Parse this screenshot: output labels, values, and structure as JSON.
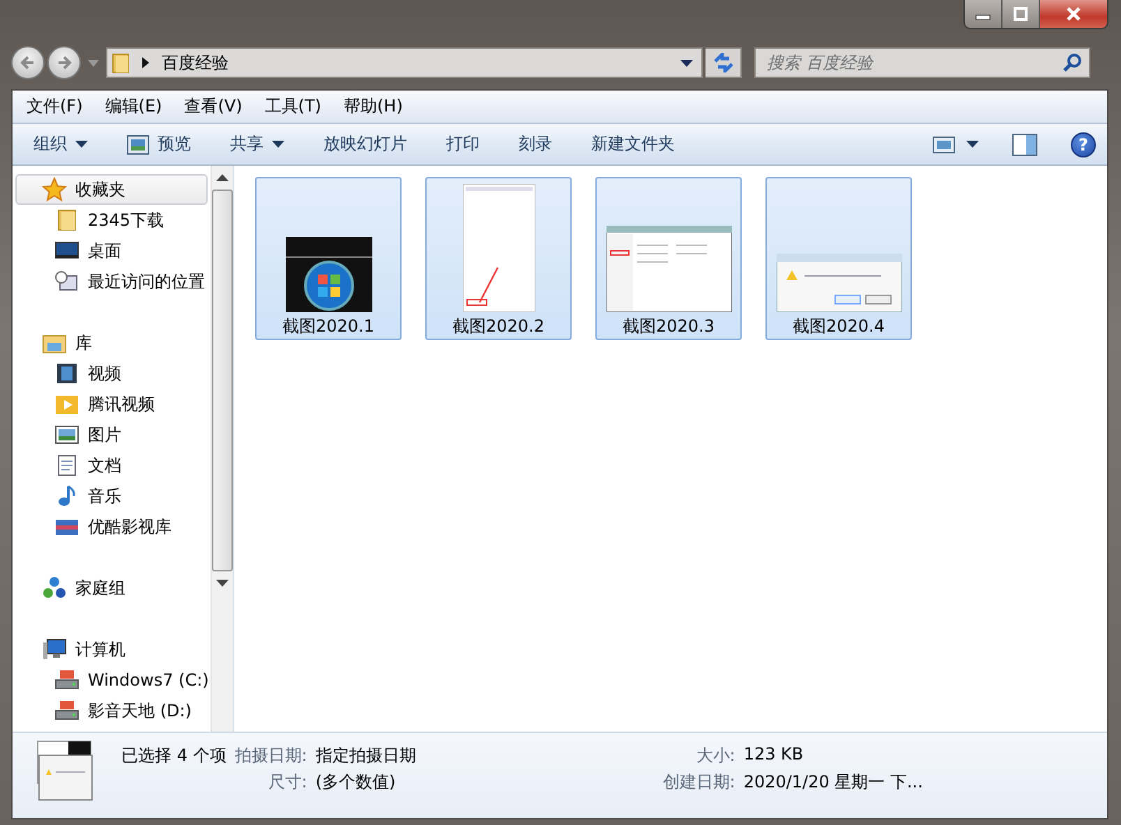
{
  "address": {
    "path": "百度经验"
  },
  "search": {
    "placeholder": "搜索 百度经验"
  },
  "help": "?",
  "menu": [
    "文件(F)",
    "编辑(E)",
    "查看(V)",
    "工具(T)",
    "帮助(H)"
  ],
  "toolbar": {
    "items": [
      {
        "label": "组织",
        "kind": "menu"
      },
      {
        "label": "预览",
        "kind": "icon"
      },
      {
        "label": "共享",
        "kind": "menu"
      },
      {
        "label": "放映幻灯片",
        "kind": "plain"
      },
      {
        "label": "打印",
        "kind": "plain"
      },
      {
        "label": "刻录",
        "kind": "plain"
      },
      {
        "label": "新建文件夹",
        "kind": "plain"
      }
    ]
  },
  "sidebar": {
    "groups": [
      {
        "label": "收藏夹",
        "kind": "star",
        "highlighted": true,
        "children": [
          {
            "label": "2345下载",
            "kind": "folder"
          },
          {
            "label": "桌面",
            "kind": "desktop"
          },
          {
            "label": "最近访问的位置",
            "kind": "recent"
          }
        ]
      },
      {
        "label": "库",
        "kind": "library",
        "highlighted": false,
        "children": [
          {
            "label": "视频",
            "kind": "video"
          },
          {
            "label": "腾讯视频",
            "kind": "player"
          },
          {
            "label": "图片",
            "kind": "picture"
          },
          {
            "label": "文档",
            "kind": "document"
          },
          {
            "label": "音乐",
            "kind": "music"
          },
          {
            "label": "优酷影视库",
            "kind": "media"
          }
        ]
      },
      {
        "label": "家庭组",
        "kind": "homegroup",
        "highlighted": false
      },
      {
        "label": "计算机",
        "kind": "computer",
        "highlighted": false,
        "children": [
          {
            "label": "Windows7 (C:)",
            "kind": "drive"
          },
          {
            "label": "影音天地 (D:)",
            "kind": "drive"
          }
        ]
      }
    ]
  },
  "files": [
    {
      "name": "截图2020.1",
      "kind": "orb",
      "selected": true
    },
    {
      "name": "截图2020.2",
      "kind": "tall",
      "selected": true
    },
    {
      "name": "截图2020.3",
      "kind": "window",
      "selected": true
    },
    {
      "name": "截图2020.4",
      "kind": "dialog",
      "selected": true
    }
  ],
  "details": {
    "summary": "已选择 4 个项",
    "fields": [
      {
        "label": "拍摄日期:",
        "value": "指定拍摄日期"
      },
      {
        "label": "尺寸:",
        "value": "(多个数值)"
      },
      {
        "label": "大小:",
        "value": "123 KB"
      },
      {
        "label": "创建日期:",
        "value": "2020/1/20 星期一 下..."
      }
    ]
  }
}
